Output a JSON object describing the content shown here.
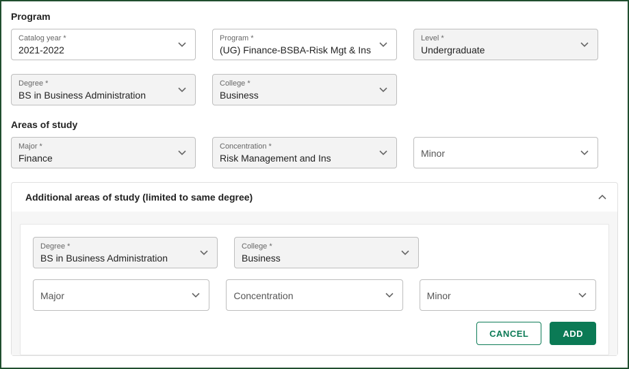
{
  "sections": {
    "program": "Program",
    "areas": "Areas of study",
    "additional": "Additional areas of study (limited to same degree)"
  },
  "program": {
    "catalog_year": {
      "label": "Catalog year *",
      "value": "2021-2022"
    },
    "program": {
      "label": "Program *",
      "value": "(UG) Finance-BSBA-Risk Mgt & Ins"
    },
    "level": {
      "label": "Level *",
      "value": "Undergraduate"
    },
    "degree": {
      "label": "Degree *",
      "value": "BS in Business Administration"
    },
    "college": {
      "label": "College *",
      "value": "Business"
    }
  },
  "areas": {
    "major": {
      "label": "Major *",
      "value": "Finance"
    },
    "concentration": {
      "label": "Concentration *",
      "value": "Risk Management and Ins"
    },
    "minor": {
      "placeholder": "Minor"
    }
  },
  "additional": {
    "degree": {
      "label": "Degree *",
      "value": "BS in Business Administration"
    },
    "college": {
      "label": "College *",
      "value": "Business"
    },
    "major": {
      "placeholder": "Major"
    },
    "concentration": {
      "placeholder": "Concentration"
    },
    "minor": {
      "placeholder": "Minor"
    }
  },
  "buttons": {
    "cancel": "CANCEL",
    "add": "ADD"
  }
}
